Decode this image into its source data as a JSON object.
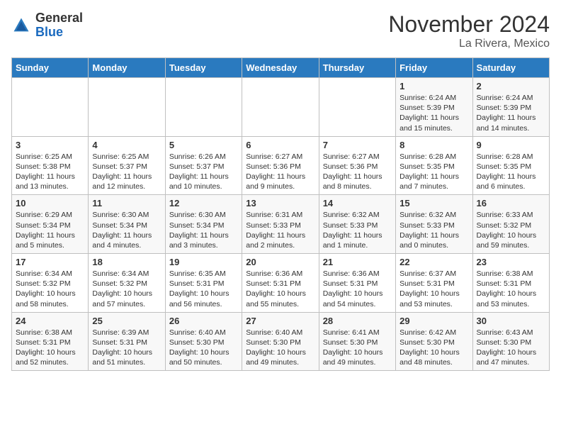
{
  "header": {
    "logo_general": "General",
    "logo_blue": "Blue",
    "month_title": "November 2024",
    "location": "La Rivera, Mexico"
  },
  "days_of_week": [
    "Sunday",
    "Monday",
    "Tuesday",
    "Wednesday",
    "Thursday",
    "Friday",
    "Saturday"
  ],
  "weeks": [
    [
      {
        "day": "",
        "content": ""
      },
      {
        "day": "",
        "content": ""
      },
      {
        "day": "",
        "content": ""
      },
      {
        "day": "",
        "content": ""
      },
      {
        "day": "",
        "content": ""
      },
      {
        "day": "1",
        "content": "Sunrise: 6:24 AM\nSunset: 5:39 PM\nDaylight: 11 hours and 15 minutes."
      },
      {
        "day": "2",
        "content": "Sunrise: 6:24 AM\nSunset: 5:39 PM\nDaylight: 11 hours and 14 minutes."
      }
    ],
    [
      {
        "day": "3",
        "content": "Sunrise: 6:25 AM\nSunset: 5:38 PM\nDaylight: 11 hours and 13 minutes."
      },
      {
        "day": "4",
        "content": "Sunrise: 6:25 AM\nSunset: 5:37 PM\nDaylight: 11 hours and 12 minutes."
      },
      {
        "day": "5",
        "content": "Sunrise: 6:26 AM\nSunset: 5:37 PM\nDaylight: 11 hours and 10 minutes."
      },
      {
        "day": "6",
        "content": "Sunrise: 6:27 AM\nSunset: 5:36 PM\nDaylight: 11 hours and 9 minutes."
      },
      {
        "day": "7",
        "content": "Sunrise: 6:27 AM\nSunset: 5:36 PM\nDaylight: 11 hours and 8 minutes."
      },
      {
        "day": "8",
        "content": "Sunrise: 6:28 AM\nSunset: 5:35 PM\nDaylight: 11 hours and 7 minutes."
      },
      {
        "day": "9",
        "content": "Sunrise: 6:28 AM\nSunset: 5:35 PM\nDaylight: 11 hours and 6 minutes."
      }
    ],
    [
      {
        "day": "10",
        "content": "Sunrise: 6:29 AM\nSunset: 5:34 PM\nDaylight: 11 hours and 5 minutes."
      },
      {
        "day": "11",
        "content": "Sunrise: 6:30 AM\nSunset: 5:34 PM\nDaylight: 11 hours and 4 minutes."
      },
      {
        "day": "12",
        "content": "Sunrise: 6:30 AM\nSunset: 5:34 PM\nDaylight: 11 hours and 3 minutes."
      },
      {
        "day": "13",
        "content": "Sunrise: 6:31 AM\nSunset: 5:33 PM\nDaylight: 11 hours and 2 minutes."
      },
      {
        "day": "14",
        "content": "Sunrise: 6:32 AM\nSunset: 5:33 PM\nDaylight: 11 hours and 1 minute."
      },
      {
        "day": "15",
        "content": "Sunrise: 6:32 AM\nSunset: 5:33 PM\nDaylight: 11 hours and 0 minutes."
      },
      {
        "day": "16",
        "content": "Sunrise: 6:33 AM\nSunset: 5:32 PM\nDaylight: 10 hours and 59 minutes."
      }
    ],
    [
      {
        "day": "17",
        "content": "Sunrise: 6:34 AM\nSunset: 5:32 PM\nDaylight: 10 hours and 58 minutes."
      },
      {
        "day": "18",
        "content": "Sunrise: 6:34 AM\nSunset: 5:32 PM\nDaylight: 10 hours and 57 minutes."
      },
      {
        "day": "19",
        "content": "Sunrise: 6:35 AM\nSunset: 5:31 PM\nDaylight: 10 hours and 56 minutes."
      },
      {
        "day": "20",
        "content": "Sunrise: 6:36 AM\nSunset: 5:31 PM\nDaylight: 10 hours and 55 minutes."
      },
      {
        "day": "21",
        "content": "Sunrise: 6:36 AM\nSunset: 5:31 PM\nDaylight: 10 hours and 54 minutes."
      },
      {
        "day": "22",
        "content": "Sunrise: 6:37 AM\nSunset: 5:31 PM\nDaylight: 10 hours and 53 minutes."
      },
      {
        "day": "23",
        "content": "Sunrise: 6:38 AM\nSunset: 5:31 PM\nDaylight: 10 hours and 53 minutes."
      }
    ],
    [
      {
        "day": "24",
        "content": "Sunrise: 6:38 AM\nSunset: 5:31 PM\nDaylight: 10 hours and 52 minutes."
      },
      {
        "day": "25",
        "content": "Sunrise: 6:39 AM\nSunset: 5:31 PM\nDaylight: 10 hours and 51 minutes."
      },
      {
        "day": "26",
        "content": "Sunrise: 6:40 AM\nSunset: 5:30 PM\nDaylight: 10 hours and 50 minutes."
      },
      {
        "day": "27",
        "content": "Sunrise: 6:40 AM\nSunset: 5:30 PM\nDaylight: 10 hours and 49 minutes."
      },
      {
        "day": "28",
        "content": "Sunrise: 6:41 AM\nSunset: 5:30 PM\nDaylight: 10 hours and 49 minutes."
      },
      {
        "day": "29",
        "content": "Sunrise: 6:42 AM\nSunset: 5:30 PM\nDaylight: 10 hours and 48 minutes."
      },
      {
        "day": "30",
        "content": "Sunrise: 6:43 AM\nSunset: 5:30 PM\nDaylight: 10 hours and 47 minutes."
      }
    ]
  ]
}
